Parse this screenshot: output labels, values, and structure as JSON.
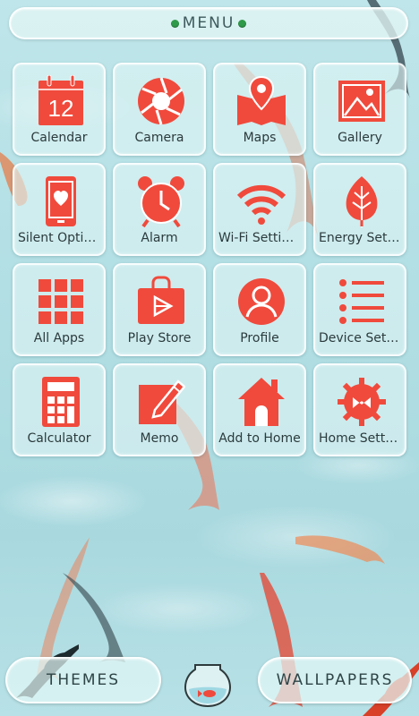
{
  "header": {
    "title": "MENU"
  },
  "apps": [
    {
      "label": "Calendar",
      "icon": "calendar-icon",
      "extra": "12"
    },
    {
      "label": "Camera",
      "icon": "camera-shutter-icon"
    },
    {
      "label": "Maps",
      "icon": "map-pin-icon"
    },
    {
      "label": "Gallery",
      "icon": "picture-icon"
    },
    {
      "label": "Silent Options",
      "icon": "phone-heart-icon"
    },
    {
      "label": "Alarm",
      "icon": "alarm-clock-icon"
    },
    {
      "label": "Wi-Fi Settings",
      "icon": "wifi-icon"
    },
    {
      "label": "Energy Setti…",
      "icon": "leaf-icon"
    },
    {
      "label": "All Apps",
      "icon": "grid-icon"
    },
    {
      "label": "Play Store",
      "icon": "store-bag-icon"
    },
    {
      "label": "Profile",
      "icon": "user-icon"
    },
    {
      "label": "Device Setti…",
      "icon": "list-icon"
    },
    {
      "label": "Calculator",
      "icon": "calculator-icon"
    },
    {
      "label": "Memo",
      "icon": "pencil-note-icon"
    },
    {
      "label": "Add to Home",
      "icon": "house-icon"
    },
    {
      "label": "Home Setti…",
      "icon": "gear-icon"
    }
  ],
  "footer": {
    "themes_label": "THEMES",
    "wallpapers_label": "WALLPAPERS",
    "center_icon": "fishbowl-icon"
  },
  "colors": {
    "icon": "#f04a3c",
    "accent_dot": "#2f9a49",
    "water": "#b2dfe4"
  }
}
